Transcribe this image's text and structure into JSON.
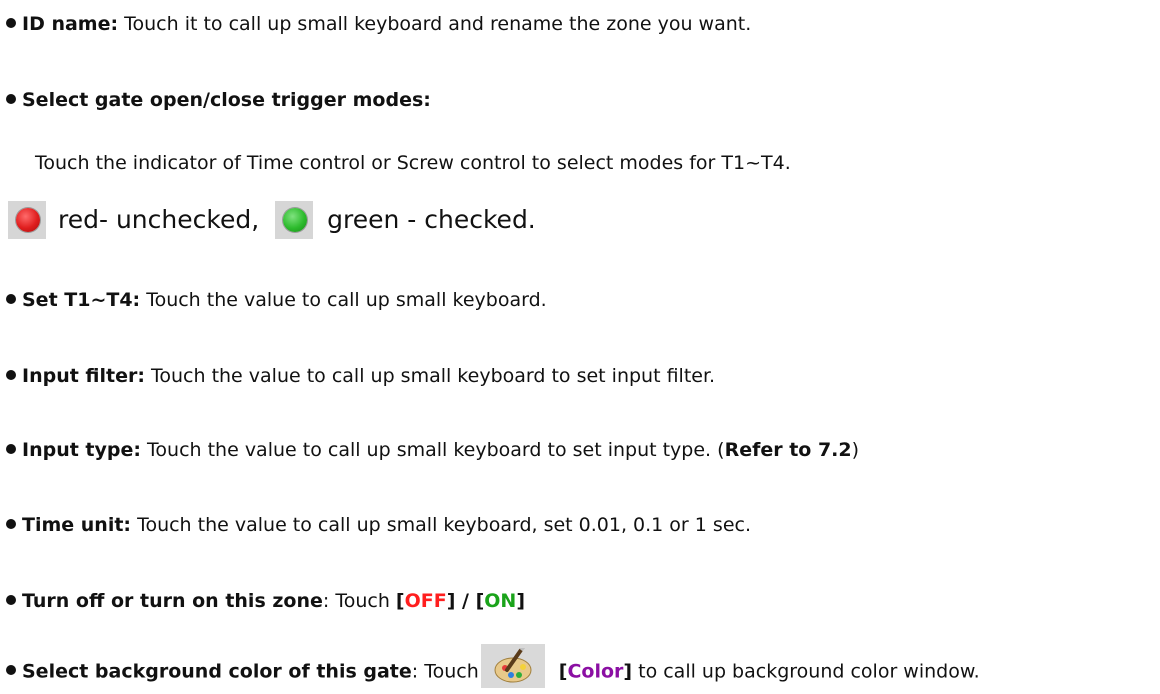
{
  "items": {
    "id_name": {
      "label": "ID name:",
      "text": " Touch it to call up small keyboard and rename the zone you want."
    },
    "trigger_modes": {
      "label": "Select gate open/close trigger modes:",
      "desc": "Touch the indicator of Time control or Screw control to select modes for T1~T4.",
      "red_text": "red- unchecked,",
      "green_text": "green - checked."
    },
    "set_t": {
      "label": "Set T1~T4:",
      "text": " Touch the value to call up small keyboard."
    },
    "input_filter": {
      "label": "Input filter:",
      "text": " Touch the value to call up small keyboard to set input filter."
    },
    "input_type": {
      "label": "Input type:",
      "text": " Touch the value to call up small keyboard to set input type. (",
      "ref": "Refer to 7.2",
      "close": ")"
    },
    "time_unit": {
      "label": "Time unit:",
      "text": " Touch the value to call up small keyboard, set 0.01, 0.1 or 1 sec."
    },
    "zone_toggle": {
      "label": "Turn off or turn on this zone",
      "text": ": Touch ",
      "br1": "[",
      "off": "OFF",
      "mid": "] / [",
      "on": "ON",
      "br2": "]"
    },
    "bg_color": {
      "label": "Select background color of this gate",
      "text": ": Touch",
      "br1": "[",
      "color": "Color",
      "br2": "]",
      "tail": " to call up background color window."
    }
  },
  "icons": {
    "red_indicator": "red-indicator-icon",
    "green_indicator": "green-indicator-icon",
    "palette": "palette-icon"
  },
  "colors": {
    "red": "#ff1e1e",
    "green": "#1aa31a",
    "purple": "#8b0fa3"
  }
}
